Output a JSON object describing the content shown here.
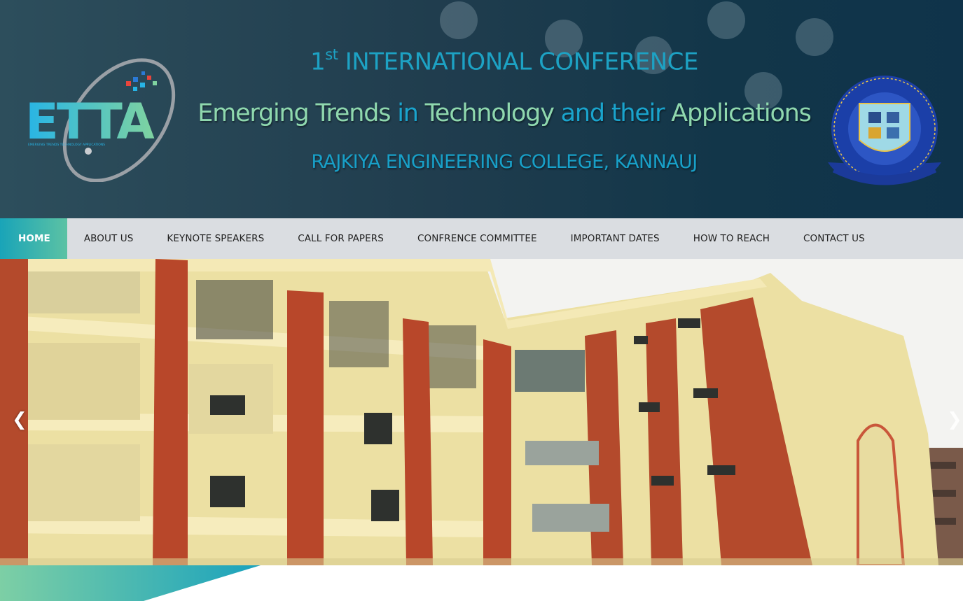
{
  "banner": {
    "title_number": "1",
    "title_suffix": "st",
    "title_rest": " INTERNATIONAL CONFERENCE",
    "subtitle_parts": [
      {
        "text": "Emerging Trends",
        "color": "green"
      },
      {
        "text": " in ",
        "color": "blue"
      },
      {
        "text": "Technology",
        "color": "green"
      },
      {
        "text": " and their ",
        "color": "blue"
      },
      {
        "text": "Applications",
        "color": "green"
      }
    ],
    "college": "RAJKIYA ENGINEERING COLLEGE, KANNAUJ",
    "logo_letters": "ETTA",
    "logo_tagline": "EMERGING TRENDS TECHNOLOGY APPLICATIONS",
    "seal_name": "college-seal"
  },
  "nav": {
    "items": [
      {
        "label": "HOME",
        "active": true
      },
      {
        "label": "ABOUT US"
      },
      {
        "label": "KEYNOTE SPEAKERS"
      },
      {
        "label": "CALL FOR PAPERS"
      },
      {
        "label": "CONFRENCE COMMITTEE"
      },
      {
        "label": "IMPORTANT DATES"
      },
      {
        "label": "HOW TO REACH"
      },
      {
        "label": "CONTACT US"
      }
    ]
  },
  "slider": {
    "prev_icon": "❮",
    "next_icon": "❯",
    "slide_image": "college-building-photo"
  },
  "colors": {
    "accent_teal": "#19a4b8",
    "accent_green": "#8fd8ae",
    "title_blue": "#1da2c4",
    "banner_dark": "#123649",
    "nav_bg": "#dadde1",
    "brick": "#b8472a",
    "cream": "#efe2a4"
  }
}
